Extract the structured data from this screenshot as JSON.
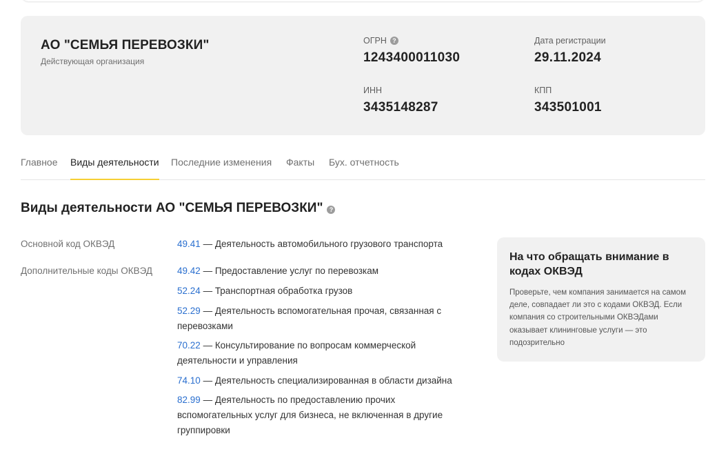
{
  "company": {
    "name": "АО \"СЕМЬЯ ПЕРЕВОЗКИ\"",
    "status": "Действующая организация",
    "ogrn_label": "ОГРН",
    "ogrn": "1243400011030",
    "reg_date_label": "Дата регистрации",
    "reg_date": "29.11.2024",
    "inn_label": "ИНН",
    "inn": "3435148287",
    "kpp_label": "КПП",
    "kpp": "343501001"
  },
  "tabs": [
    {
      "label": "Главное",
      "active": false
    },
    {
      "label": "Виды деятельности",
      "active": true
    },
    {
      "label": "Последние изменения",
      "active": false
    },
    {
      "label": "Факты",
      "active": false
    },
    {
      "label": "Бух. отчетность",
      "active": false
    }
  ],
  "section": {
    "title": "Виды деятельности АО \"СЕМЬЯ ПЕРЕВОЗКИ\"",
    "main_label": "Основной код ОКВЭД",
    "additional_label": "Дополнительные коды ОКВЭД",
    "main": {
      "code": "49.41",
      "text": "— Деятельность автомобильного грузового транспорта"
    },
    "additional": [
      {
        "code": "49.42",
        "text": "— Предоставление услуг по перевозкам"
      },
      {
        "code": "52.24",
        "text": "— Транспортная обработка грузов"
      },
      {
        "code": "52.29",
        "text": "— Деятельность вспомогательная прочая, связанная с перевозками"
      },
      {
        "code": "70.22",
        "text": "— Консультирование по вопросам коммерческой деятельности и управления"
      },
      {
        "code": "74.10",
        "text": "— Деятельность специализированная в области дизайна"
      },
      {
        "code": "82.99",
        "text": "— Деятельность по предоставлению прочих вспомогательных услуг для бизнеса, не включенная в другие группировки"
      }
    ]
  },
  "side": {
    "title": "На что обращать внимание в кодах ОКВЭД",
    "text": "Проверьте, чем компания занимается на самом деле, совпадает ли это с кодами ОКВЭД. Если компания со строительными ОКВЭДами оказывает клининговые услуги — это подозрительно"
  },
  "icons": {
    "help": "question-circle-icon"
  },
  "colors": {
    "accent": "#f6cf33",
    "link": "#2a6fcf",
    "card": "#f1f1f1"
  }
}
